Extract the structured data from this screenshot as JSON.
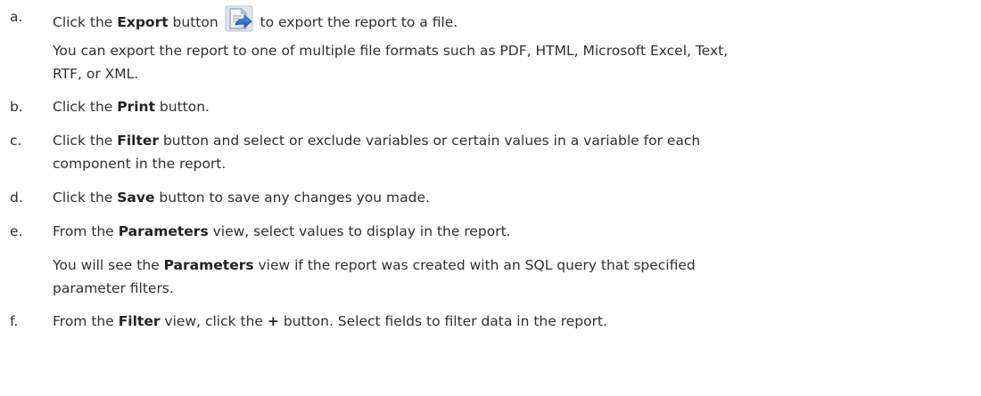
{
  "steps": [
    {
      "marker": "a.",
      "pre": "Click the ",
      "bold": "Export",
      "mid": " button",
      "post": " to export the report to a file.",
      "icon": "export-icon",
      "note_line1": "You can export the report to one of multiple file formats such as PDF, HTML, Microsoft Excel, Text,",
      "note_line2": "RTF, or XML."
    },
    {
      "marker": "b.",
      "pre": "Click the ",
      "bold": "Print",
      "post": " button."
    },
    {
      "marker": "c.",
      "pre": "Click the ",
      "bold": "Filter",
      "post": " button and select or exclude variables or certain values in a variable for each",
      "line2": "component in the report."
    },
    {
      "marker": "d.",
      "pre": "Click the ",
      "bold": "Save",
      "post": " button to save any changes you made."
    },
    {
      "marker": "e.",
      "pre": "From the ",
      "bold": "Parameters",
      "post": " view, select values to display in the report.",
      "note_pre": "You will see the ",
      "note_bold": "Parameters",
      "note_post": " view if the report was created with an SQL query that specified",
      "note_line2": "parameter filters."
    },
    {
      "marker": "f.",
      "pre": "From the ",
      "bold": "Filter",
      "mid": " view, click the ",
      "bold2": "+",
      "post": " button. Select fields to filter data in the report."
    }
  ],
  "colors": {
    "text": "#303030",
    "icon_blue": "#2a6fc9",
    "icon_page": "#e9eef6"
  }
}
